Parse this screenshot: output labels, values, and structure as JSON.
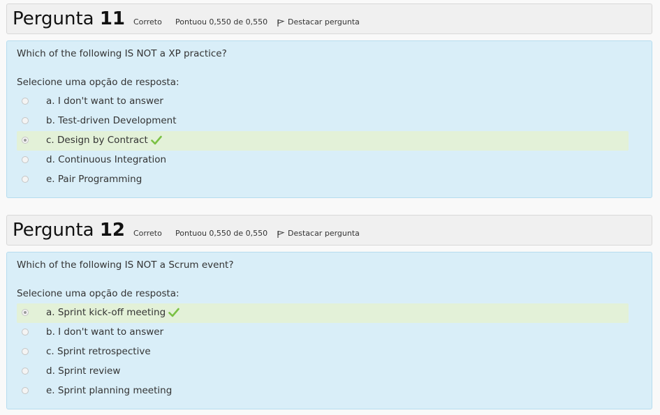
{
  "questions": [
    {
      "label": "Pergunta",
      "number": "11",
      "state": "Correto",
      "grade": "Pontuou 0,550 de 0,550",
      "flag_label": "Destacar pergunta",
      "text": "Which of the following IS NOT a XP practice?",
      "prompt": "Selecione uma opção de resposta:",
      "options": [
        {
          "label": "a. I don't want to answer"
        },
        {
          "label": "b. Test-driven Development"
        },
        {
          "label": "c. Design by Contract"
        },
        {
          "label": "d. Continuous Integration"
        },
        {
          "label": "e. Pair Programming"
        }
      ],
      "selected_option": "c. Design by Contract"
    },
    {
      "label": "Pergunta",
      "number": "12",
      "state": "Correto",
      "grade": "Pontuou 0,550 de 0,550",
      "flag_label": "Destacar pergunta",
      "text": "Which of the following IS NOT a Scrum event?",
      "prompt": "Selecione uma opção de resposta:",
      "options": [
        {
          "label": "a. Sprint kick-off meeting"
        },
        {
          "label": "b. I don't want to answer"
        },
        {
          "label": "c. Sprint retrospective"
        },
        {
          "label": "d. Sprint review"
        },
        {
          "label": "e. Sprint planning meeting"
        }
      ],
      "selected_option": "a. Sprint kick-off meeting"
    }
  ],
  "icons": {
    "flag": "flag-icon",
    "correct": "checkmark-icon"
  },
  "colors": {
    "info_bg": "#f0f0f0",
    "content_bg": "#d9eef8",
    "correct_bg": "#e3f1d8",
    "check": "#7ac143"
  }
}
